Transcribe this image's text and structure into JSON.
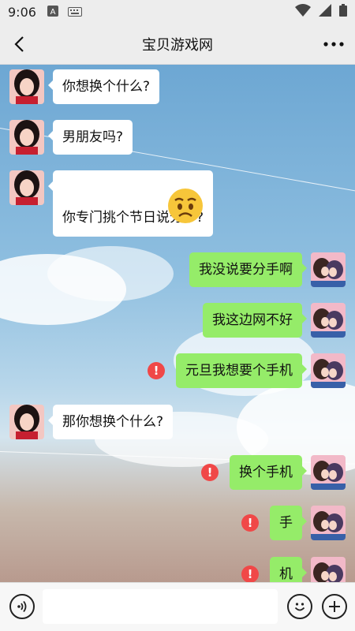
{
  "status_bar": {
    "time": "9:06"
  },
  "header": {
    "title": "宝贝游戏网"
  },
  "messages": [
    {
      "side": "left",
      "text": "你想换个什么?"
    },
    {
      "side": "left",
      "text": "男朋友吗?"
    },
    {
      "side": "left",
      "text": "你专门挑个节日说分手?",
      "emoji": "sad-face"
    },
    {
      "side": "right",
      "text": "我没说要分手啊"
    },
    {
      "side": "right",
      "text": "我这边网不好"
    },
    {
      "side": "right",
      "text": "元旦我想要个手机",
      "error": true
    },
    {
      "side": "left",
      "text": "那你想换个什么?"
    },
    {
      "side": "right",
      "text": "换个手机",
      "error": true
    },
    {
      "side": "right",
      "text": "手",
      "error": true
    },
    {
      "side": "right",
      "text": "机",
      "error": true
    }
  ],
  "colors": {
    "sent_bubble": "#95ec69",
    "received_bubble": "#ffffff",
    "error": "#f04848"
  },
  "icons": {
    "back": "chevron-left-icon",
    "more": "more-dots-icon",
    "voice": "voice-icon",
    "emoji": "emoji-icon",
    "plus": "plus-icon"
  }
}
